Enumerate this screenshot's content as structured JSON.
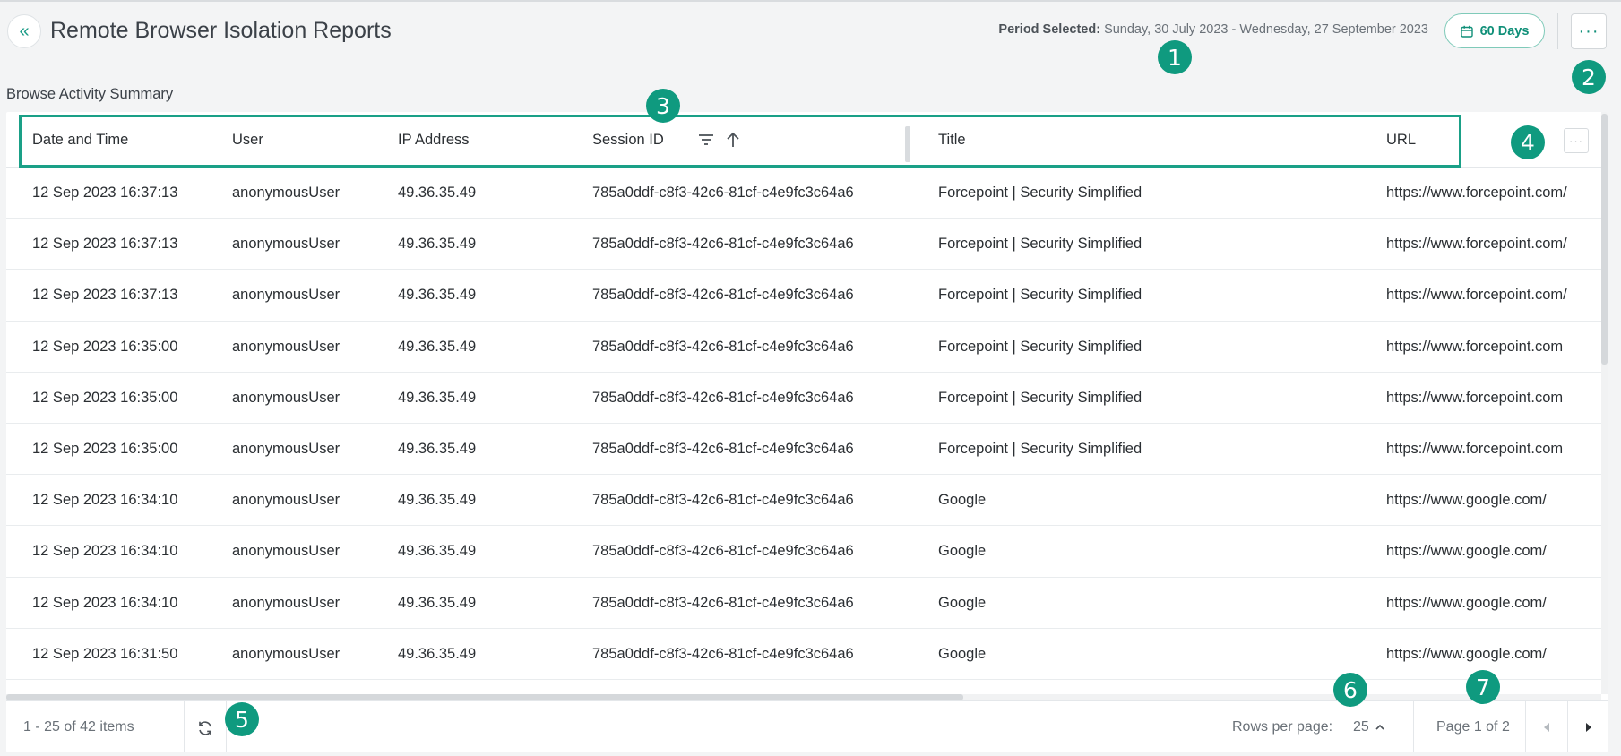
{
  "header": {
    "back_icon": "«",
    "title": "Remote Browser Isolation Reports",
    "period_label": "Period Selected:",
    "period_value": "Sunday, 30 July 2023 - Wednesday, 27 September 2023",
    "days_button": "60 Days",
    "more_icon": "···"
  },
  "section": {
    "title": "Browse Activity Summary"
  },
  "table": {
    "columns": [
      "Date and Time",
      "User",
      "IP Address",
      "Session ID",
      "Title",
      "URL"
    ],
    "column_menu_icon": "···",
    "rows": [
      [
        "12 Sep 2023 16:37:13",
        "anonymousUser",
        "49.36.35.49",
        "785a0ddf-c8f3-42c6-81cf-c4e9fc3c64a6",
        "Forcepoint | Security Simplified",
        "https://www.forcepoint.com/"
      ],
      [
        "12 Sep 2023 16:37:13",
        "anonymousUser",
        "49.36.35.49",
        "785a0ddf-c8f3-42c6-81cf-c4e9fc3c64a6",
        "Forcepoint | Security Simplified",
        "https://www.forcepoint.com/"
      ],
      [
        "12 Sep 2023 16:37:13",
        "anonymousUser",
        "49.36.35.49",
        "785a0ddf-c8f3-42c6-81cf-c4e9fc3c64a6",
        "Forcepoint | Security Simplified",
        "https://www.forcepoint.com/"
      ],
      [
        "12 Sep 2023 16:35:00",
        "anonymousUser",
        "49.36.35.49",
        "785a0ddf-c8f3-42c6-81cf-c4e9fc3c64a6",
        "Forcepoint | Security Simplified",
        "https://www.forcepoint.com"
      ],
      [
        "12 Sep 2023 16:35:00",
        "anonymousUser",
        "49.36.35.49",
        "785a0ddf-c8f3-42c6-81cf-c4e9fc3c64a6",
        "Forcepoint | Security Simplified",
        "https://www.forcepoint.com"
      ],
      [
        "12 Sep 2023 16:35:00",
        "anonymousUser",
        "49.36.35.49",
        "785a0ddf-c8f3-42c6-81cf-c4e9fc3c64a6",
        "Forcepoint | Security Simplified",
        "https://www.forcepoint.com"
      ],
      [
        "12 Sep 2023 16:34:10",
        "anonymousUser",
        "49.36.35.49",
        "785a0ddf-c8f3-42c6-81cf-c4e9fc3c64a6",
        "Google",
        "https://www.google.com/"
      ],
      [
        "12 Sep 2023 16:34:10",
        "anonymousUser",
        "49.36.35.49",
        "785a0ddf-c8f3-42c6-81cf-c4e9fc3c64a6",
        "Google",
        "https://www.google.com/"
      ],
      [
        "12 Sep 2023 16:34:10",
        "anonymousUser",
        "49.36.35.49",
        "785a0ddf-c8f3-42c6-81cf-c4e9fc3c64a6",
        "Google",
        "https://www.google.com/"
      ],
      [
        "12 Sep 2023 16:31:50",
        "anonymousUser",
        "49.36.35.49",
        "785a0ddf-c8f3-42c6-81cf-c4e9fc3c64a6",
        "Google",
        "https://www.google.com/"
      ]
    ]
  },
  "footer": {
    "items_text": "1 - 25 of 42 items",
    "rows_per_page_label": "Rows per page:",
    "rows_per_page_value": "25",
    "page_text": "Page 1 of 2"
  },
  "badges": [
    "1",
    "2",
    "3",
    "4",
    "5",
    "6",
    "7"
  ],
  "icons": {
    "back": "double-chevron-left-icon",
    "calendar": "calendar-icon",
    "more": "ellipsis-icon",
    "filter": "filter-icon",
    "sort": "sort-ascending-icon",
    "refresh": "refresh-icon",
    "rows_toggle": "chevron-up-icon",
    "prev": "caret-left-icon",
    "next": "caret-right-icon"
  },
  "colors": {
    "accent": "#0f8f78",
    "badge": "#0f9a7f",
    "highlight_border": "#1aa087",
    "background": "#f3f4f5"
  }
}
